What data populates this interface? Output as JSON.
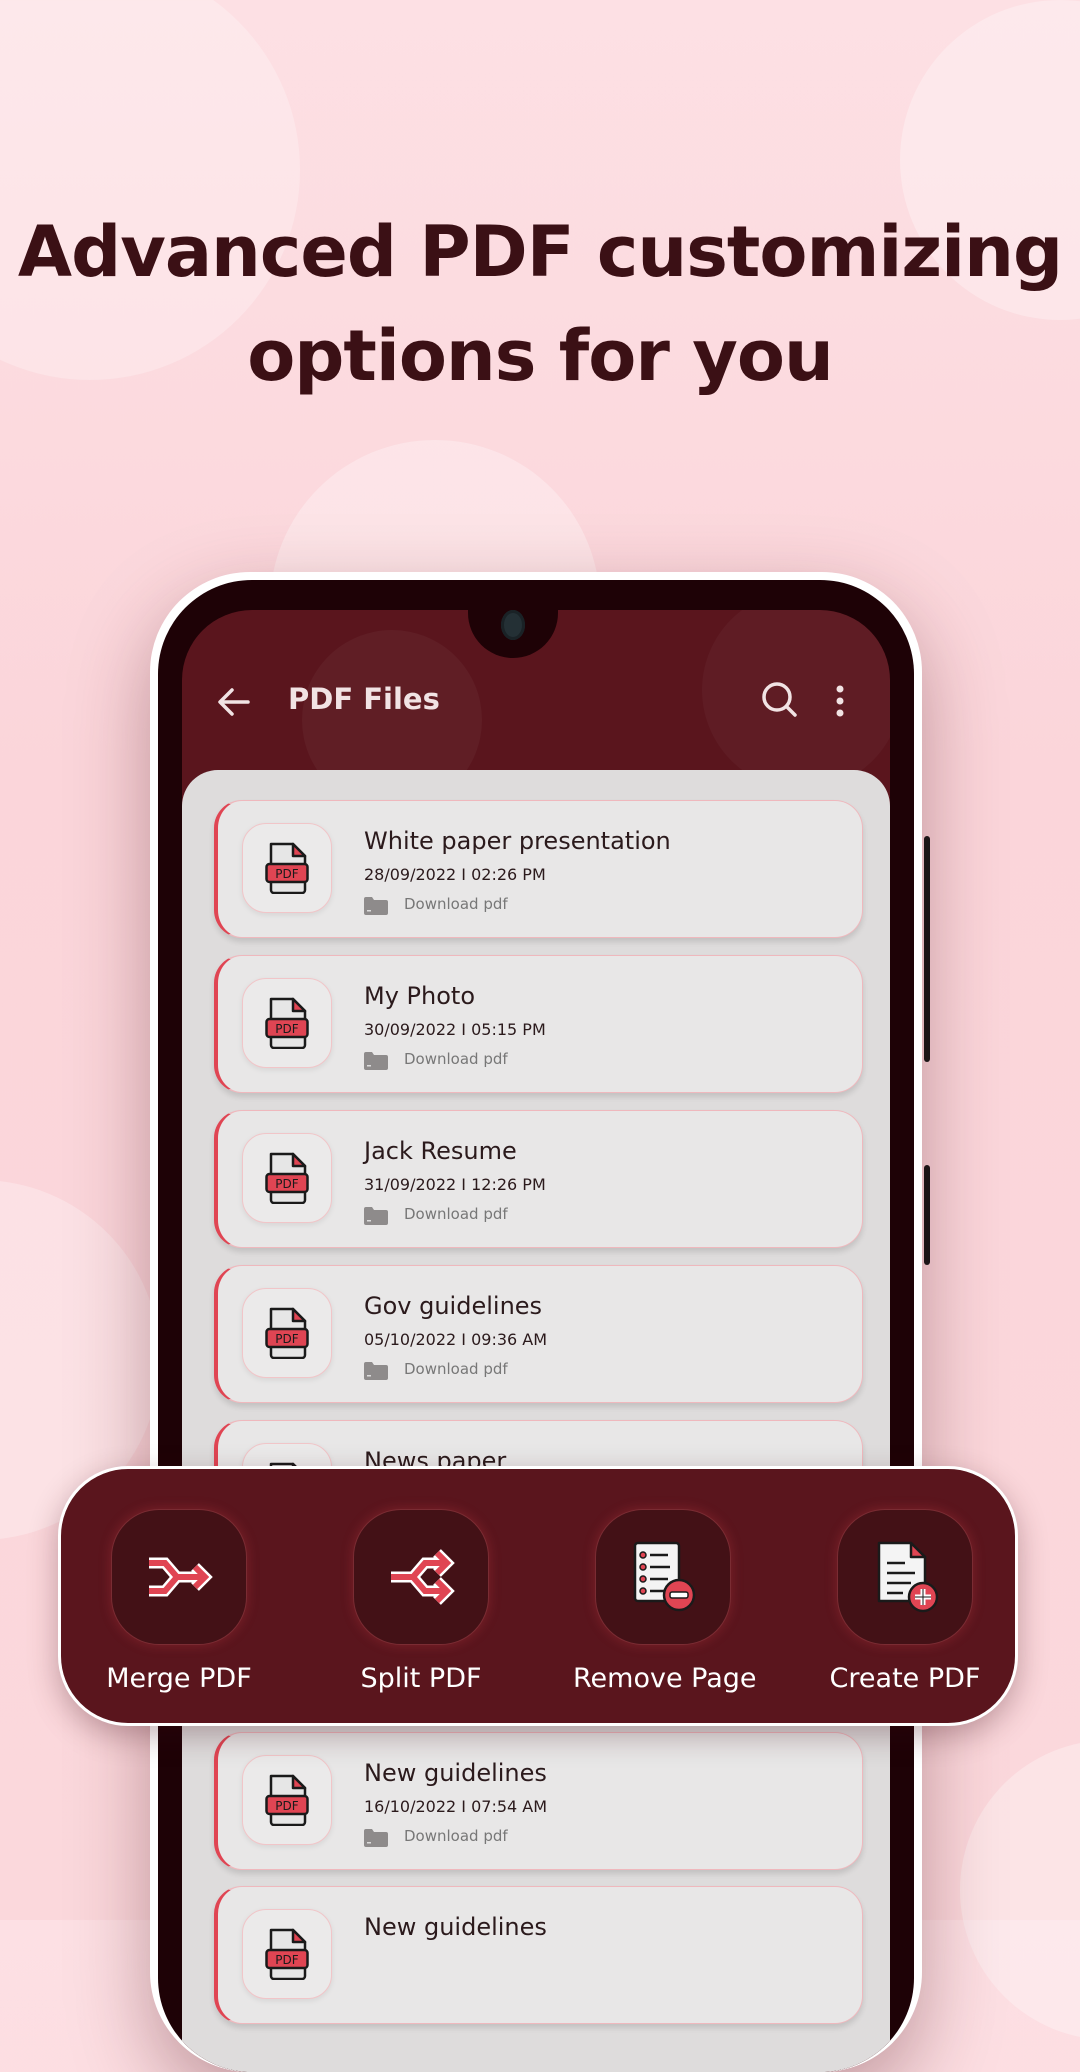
{
  "headline": {
    "line1": "Advanced PDF customizing",
    "line2": "options for you"
  },
  "app": {
    "title": "PDF Files",
    "icons": {
      "back": "arrow-left-icon",
      "search": "search-icon",
      "more": "more-vertical-icon"
    },
    "files": [
      {
        "name": "White paper presentation",
        "date": "28/09/2022 I 02:26 PM",
        "location": "Download pdf"
      },
      {
        "name": "My Photo",
        "date": "30/09/2022 I 05:15 PM",
        "location": "Download pdf"
      },
      {
        "name": "Jack Resume",
        "date": "31/09/2022 I 12:26 PM",
        "location": "Download pdf"
      },
      {
        "name": "Gov guidelines",
        "date": "05/10/2022 I 09:36 AM",
        "location": "Download pdf"
      },
      {
        "name": "News paper",
        "date": "",
        "location": ""
      },
      {
        "name": "New guidelines",
        "date": "16/10/2022 I 07:54 AM",
        "location": "Download pdf"
      },
      {
        "name": "New guidelines",
        "date": "",
        "location": ""
      }
    ],
    "file_icon_label": "PDF"
  },
  "tools": [
    {
      "label": "Merge PDF",
      "icon": "merge-icon"
    },
    {
      "label": "Split PDF",
      "icon": "split-icon"
    },
    {
      "label": "Remove Page",
      "icon": "remove-page-icon"
    },
    {
      "label": "Create PDF",
      "icon": "create-pdf-icon"
    }
  ],
  "colors": {
    "brand": "#5a151d",
    "accent": "#e04553",
    "headline": "#3b1015"
  }
}
